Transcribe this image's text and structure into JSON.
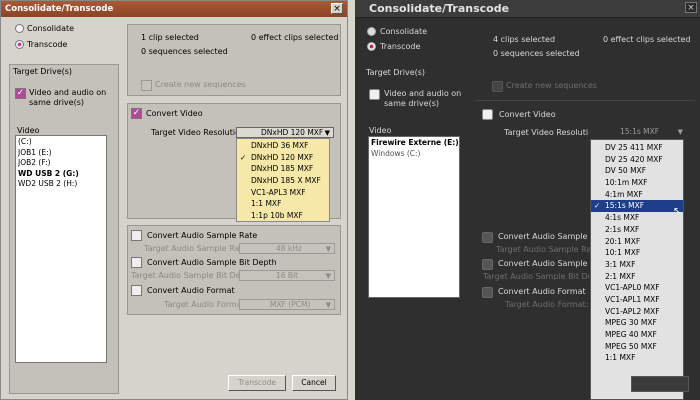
{
  "left_window": {
    "title": "Consolidate/Transcode",
    "close_glyph": "×",
    "mode": {
      "consolidate": "Consolidate",
      "transcode": "Transcode"
    },
    "summary": {
      "clips_selected": "1 clip selected",
      "effect_clips_selected": "0 effect clips selected",
      "sequences_selected": "0 sequences selected"
    },
    "create_new_sequences": "Create new sequences",
    "target_drives": {
      "label": "Target Drive(s)",
      "same_drive_label": "Video and audio on same drive(s)",
      "video_label": "Video",
      "drives": [
        "(C:)",
        "JOB1 (E:)",
        "JOB2 (F:)",
        "WD USB 2 (G:)",
        "WD2 USB 2 (H:)"
      ]
    },
    "convert_video": {
      "label": "Convert Video",
      "resolution_label": "Target Video Resolution:",
      "selected": "DNxHD 120  MXF",
      "options": [
        "DNxHD 36  MXF",
        "DNxHD 120  MXF",
        "DNxHD 185  MXF",
        "DNxHD 185 X  MXF",
        "VC1-APL3  MXF",
        "1:1  MXF",
        "1:1p 10b  MXF"
      ]
    },
    "audio": {
      "convert_sample_rate": "Convert Audio Sample Rate",
      "target_sample_rate_label": "Target Audio Sample Rate:",
      "target_sample_rate_value": "48 kHz",
      "convert_bit_depth": "Convert Audio Sample Bit Depth",
      "target_bit_depth_label": "Target Audio Sample Bit Depth:",
      "target_bit_depth_value": "16 Bit",
      "convert_format": "Convert Audio Format",
      "target_format_label": "Target Audio Format:",
      "target_format_value": "MXF (PCM)"
    },
    "buttons": {
      "transcode": "Transcode",
      "cancel": "Cancel"
    }
  },
  "right_window": {
    "title": "Consolidate/Transcode",
    "close_glyph": "×",
    "mode": {
      "consolidate": "Consolidate",
      "transcode": "Transcode"
    },
    "summary": {
      "clips_selected": "4 clips selected",
      "effect_clips_selected": "0 effect clips selected",
      "sequences_selected": "0 sequences selected"
    },
    "create_new_sequences": "Create new sequences",
    "target_drives": {
      "label": "Target Drive(s)",
      "same_drive_label": "Video and audio on same drive(s)",
      "video_label": "Video",
      "drives": [
        "Firewire Externe (E:)",
        "Windows (C:)"
      ]
    },
    "convert_video": {
      "label": "Convert Video",
      "resolution_label": "Target Video Resolution:",
      "selected": "15:1s  MXF",
      "options": [
        "DV 25 411  MXF",
        "DV 25 420  MXF",
        "DV 50  MXF",
        "10:1m  MXF",
        "4:1m  MXF",
        "15:1s  MXF",
        "4:1s  MXF",
        "2:1s  MXF",
        "20:1  MXF",
        "10:1  MXF",
        "3:1  MXF",
        "2:1  MXF",
        "VC1-APL0  MXF",
        "VC1-APL1  MXF",
        "VC1-APL2  MXF",
        "MPEG 30  MXF",
        "MPEG 40  MXF",
        "MPEG 50  MXF",
        "1:1  MXF"
      ]
    },
    "audio": {
      "convert_sample_rate": "Convert Audio Sample Rate",
      "target_sample_rate_label": "Target Audio Sample Rate:",
      "convert_bit_depth": "Convert Audio Sample Bit Depth",
      "target_bit_depth_label": "Target Audio Sample Bit Depth:",
      "convert_format": "Convert Audio Format",
      "target_format_label": "Target Audio Format:"
    }
  }
}
